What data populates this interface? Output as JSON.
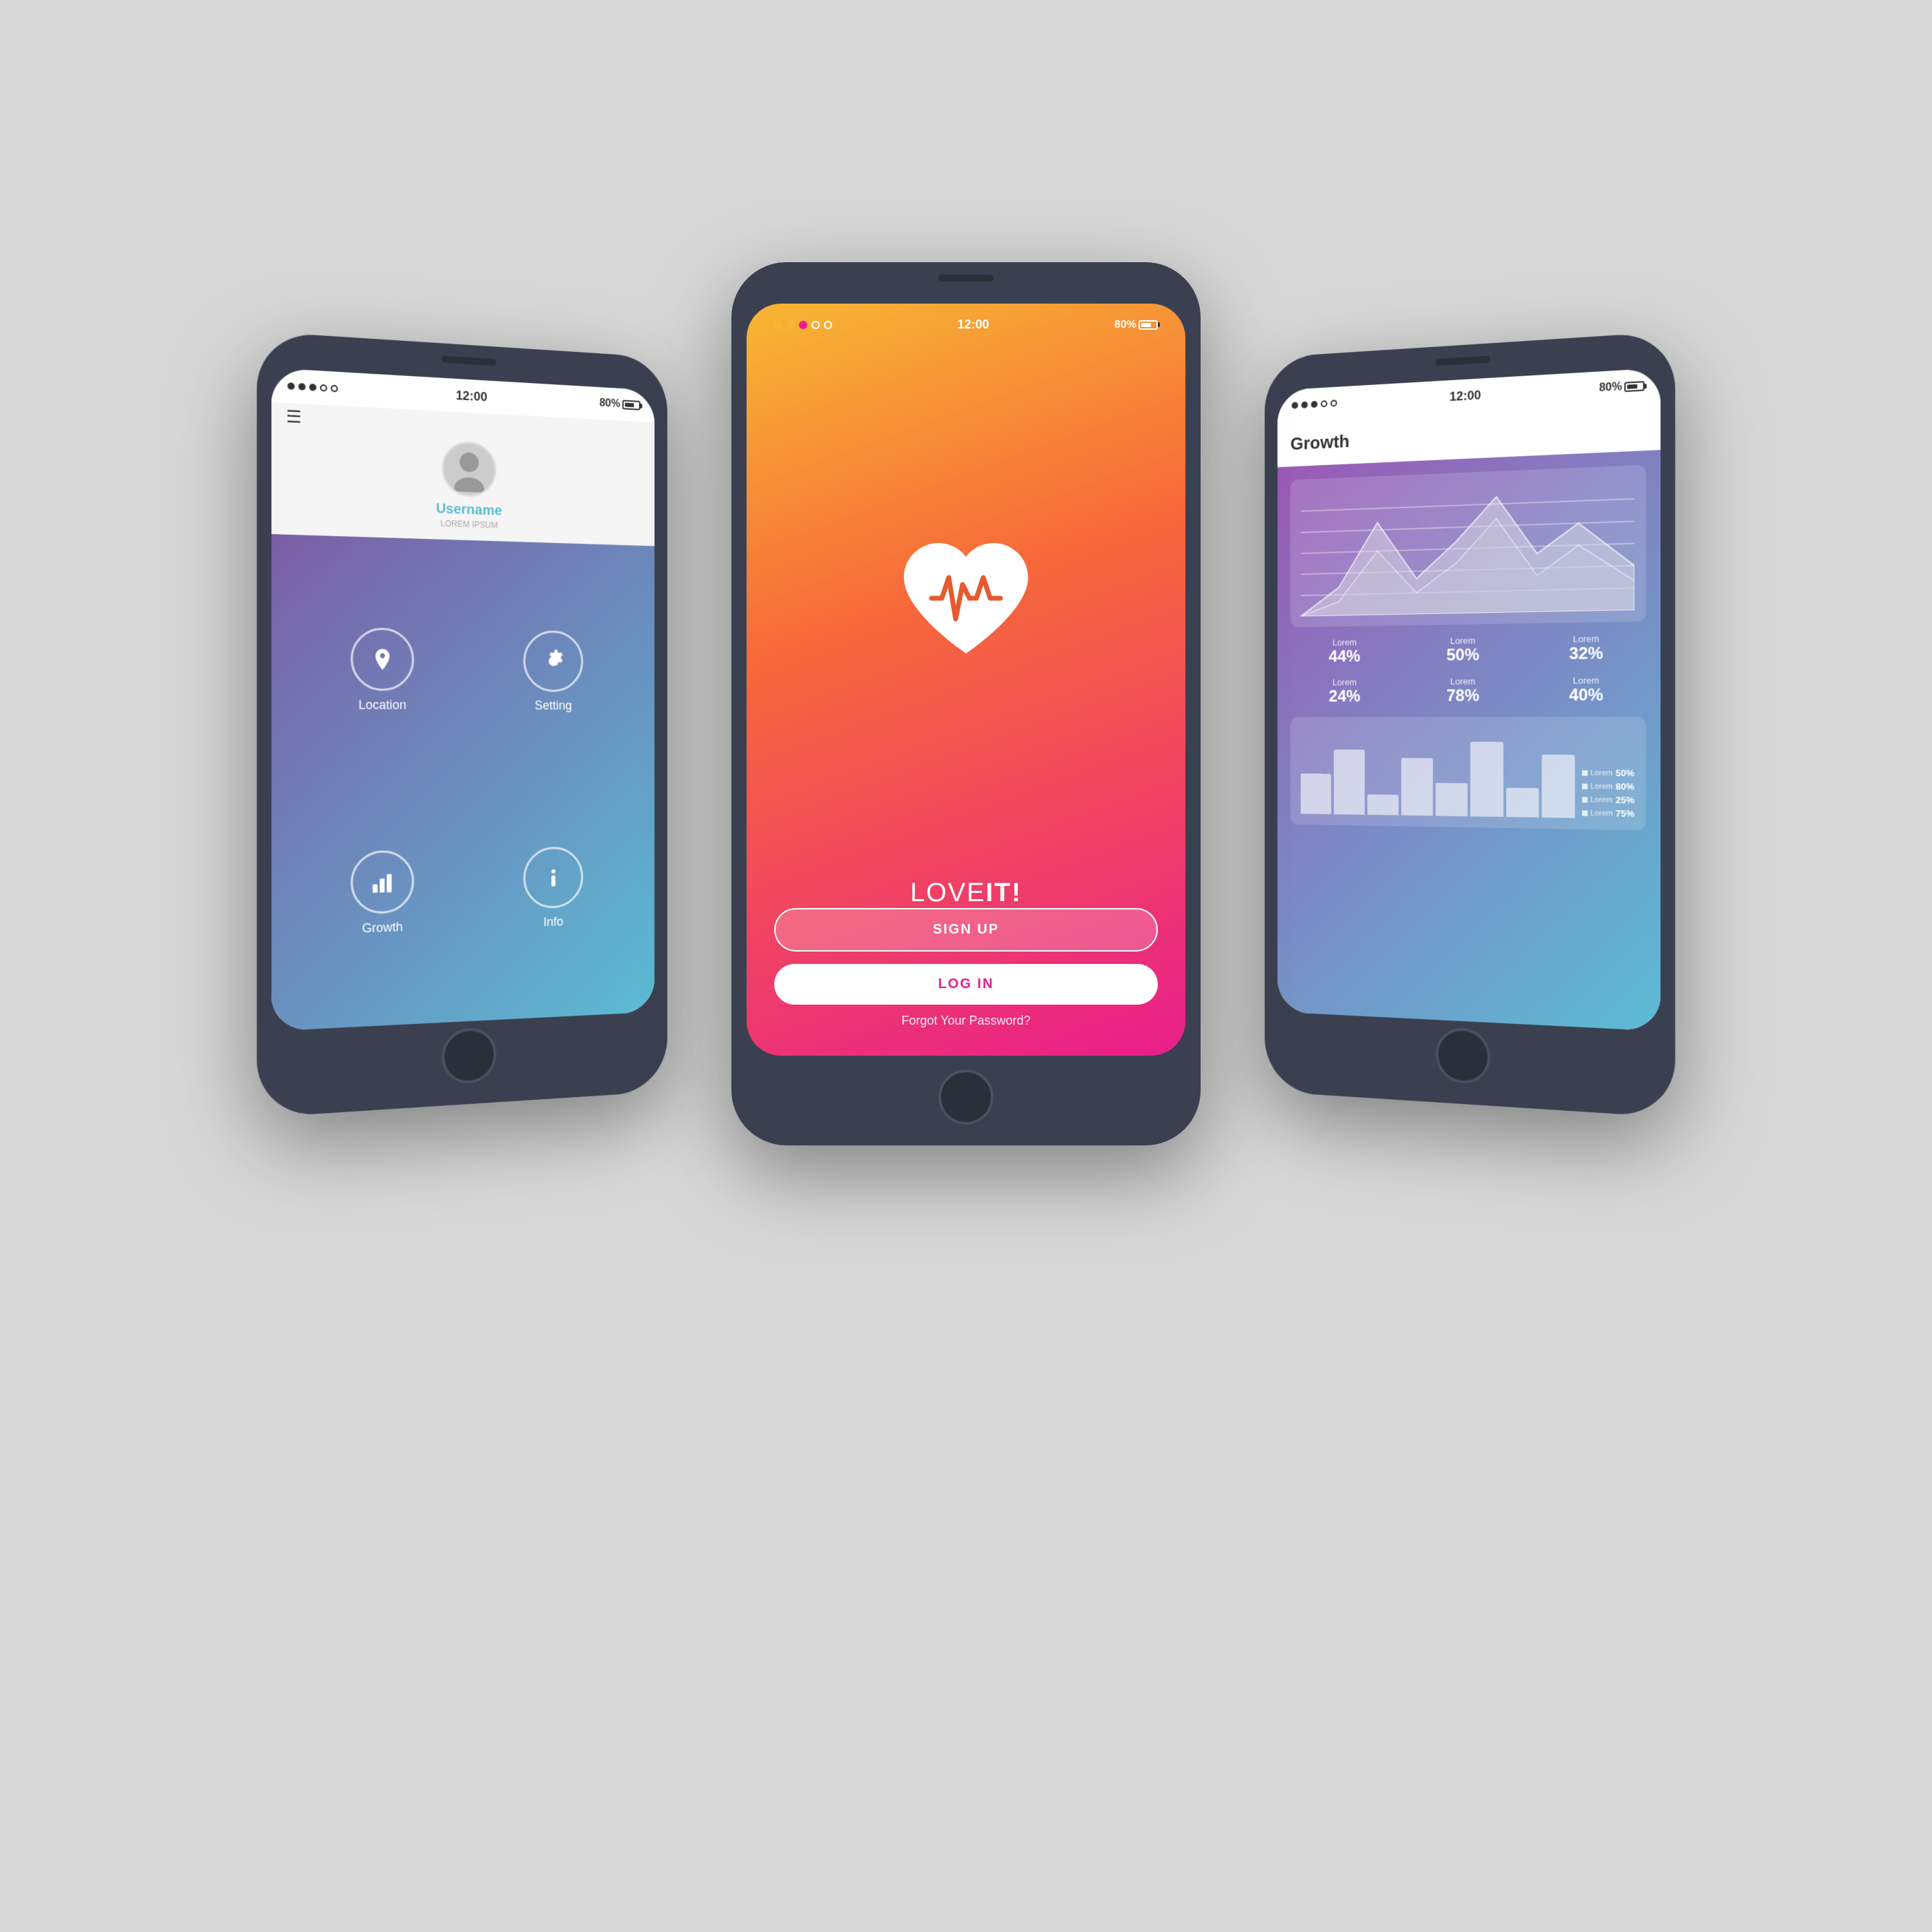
{
  "scene": {
    "bg_color": "#d8d8d8"
  },
  "left_phone": {
    "status": {
      "time": "12:00",
      "battery": "80%"
    },
    "header": {
      "username": "Username",
      "subtitle": "LOREM IPSUM"
    },
    "menu_items": [
      {
        "label": "Location",
        "icon": "location-icon"
      },
      {
        "label": "Setting",
        "icon": "settings-icon"
      },
      {
        "label": "Growth",
        "icon": "chart-icon"
      },
      {
        "label": "Info",
        "icon": "info-icon"
      }
    ]
  },
  "center_phone": {
    "status": {
      "time": "12:00",
      "battery": "80%"
    },
    "brand": "LOVEIT!",
    "brand_bold": "IT!",
    "buttons": {
      "signup": "SIGN UP",
      "login": "LOG IN",
      "forgot": "Forgot Your Password?"
    }
  },
  "right_phone": {
    "status": {
      "time": "12:00",
      "battery": "80%"
    },
    "title": "Growth",
    "stats_row1": [
      {
        "label": "Lorem",
        "value": "44%"
      },
      {
        "label": "Lorem",
        "value": "50%"
      },
      {
        "label": "Lorem",
        "value": "32%"
      }
    ],
    "stats_row2": [
      {
        "label": "Lorem",
        "value": "24%"
      },
      {
        "label": "Lorem",
        "value": "78%"
      },
      {
        "label": "Lorem",
        "value": "40%"
      }
    ],
    "legend": [
      {
        "key": "Lorem",
        "value": "50%"
      },
      {
        "key": "Lorem",
        "value": "80%"
      },
      {
        "key": "Lorem",
        "value": "25%"
      },
      {
        "key": "Lorem",
        "value": "75%"
      }
    ]
  }
}
